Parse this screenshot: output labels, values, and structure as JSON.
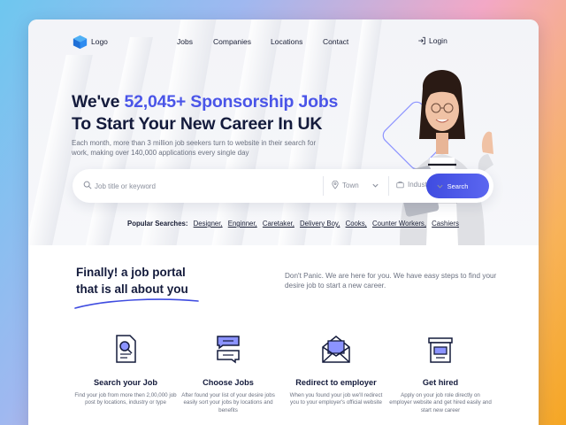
{
  "colors": {
    "accent": "#4a55e8",
    "dark": "#141b3c",
    "muted": "#6b7180"
  },
  "nav": {
    "logo_label": "Logo",
    "links": [
      "Jobs",
      "Companies",
      "Locations",
      "Contact"
    ],
    "login_label": "Login"
  },
  "hero": {
    "headline_pre": "We've ",
    "headline_highlight": "52,045+ Sponsorship Jobs",
    "headline_line2": "To Start Your New Career In UK",
    "subtext": "Each month, more than 3 million job seekers turn to website in their search for work, making over 140,000 applications every single day"
  },
  "search": {
    "placeholder": "Job title or keyword",
    "location_label": "Town",
    "industry_label": "Industry",
    "button_label": "Search"
  },
  "popular": {
    "label": "Popular Searches:",
    "items": [
      "Designer,",
      "Enginner,",
      "Caretaker,",
      "Delivery Boy,",
      "Cooks,",
      "Counter Workers,",
      "Cashiers"
    ]
  },
  "intro": {
    "title_line1": "Finally! a job portal",
    "title_line2": "that is all about you",
    "text": "Don't Panic. We are here for you. We have easy steps to find your desire job to start a new career."
  },
  "features": [
    {
      "icon": "search-document-icon",
      "title": "Search your Job",
      "desc": "Find your job from more then 2,00,000 job post by locations, industry or type"
    },
    {
      "icon": "chat-bubbles-icon",
      "title": "Choose Jobs",
      "desc": "After found your list of your desire jobs easily sort your jobs by locations and benefits"
    },
    {
      "icon": "envelope-icon",
      "title": "Redirect to employer",
      "desc": "When you found your job we'll redirect you to your employer's official website"
    },
    {
      "icon": "mailbox-icon",
      "title": "Get hired",
      "desc": "Apply on your job role directly on employer website and get hired easily and start new career"
    }
  ]
}
